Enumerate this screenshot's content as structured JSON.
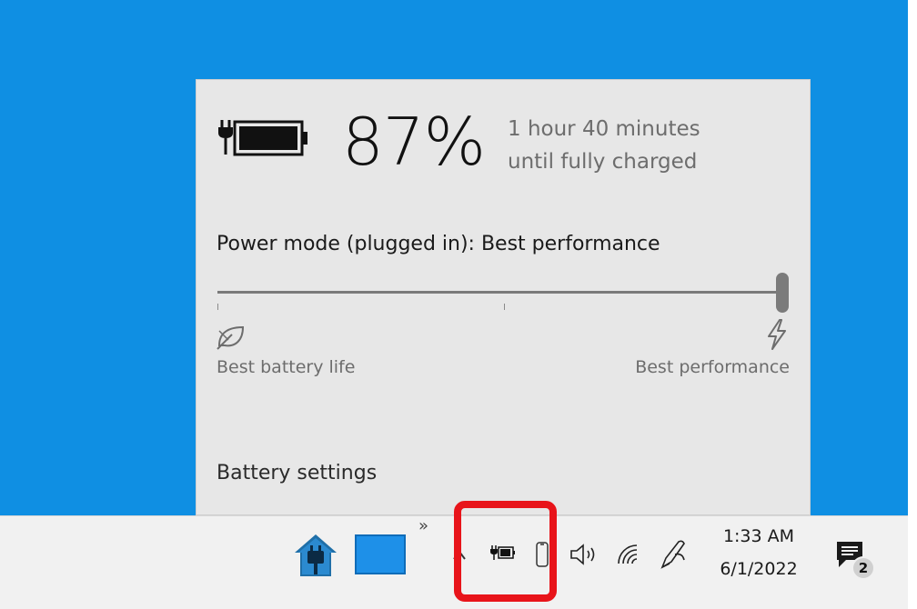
{
  "flyout": {
    "percent": "87%",
    "eta_line1": "1 hour 40 minutes",
    "eta_line2": "until fully charged",
    "power_mode": "Power mode (plugged in): Best performance",
    "slider": {
      "value_fraction": 1.0,
      "left_label": "Best battery life",
      "right_label": "Best performance",
      "left_icon": "leaf-icon",
      "right_icon": "lightning-bolt-icon"
    },
    "battery_settings_link": "Battery settings"
  },
  "taskbar": {
    "overflow_chevrons": "»",
    "pinned": [
      "home-plug-app-icon",
      "blank-window-app-icon"
    ],
    "tray_icons": [
      "show-hidden-icons-caret",
      "battery-charging-icon",
      "phone-link-icon",
      "volume-icon",
      "wifi-icon",
      "pen-icon"
    ],
    "clock": {
      "time": "1:33 AM",
      "date": "6/1/2022"
    },
    "notifications": {
      "count": "2"
    }
  },
  "colors": {
    "desktop": "#0f8fe3",
    "flyout_bg": "#e7e7e7",
    "taskbar_bg": "#f1f1f1",
    "highlight": "#e8141a"
  }
}
